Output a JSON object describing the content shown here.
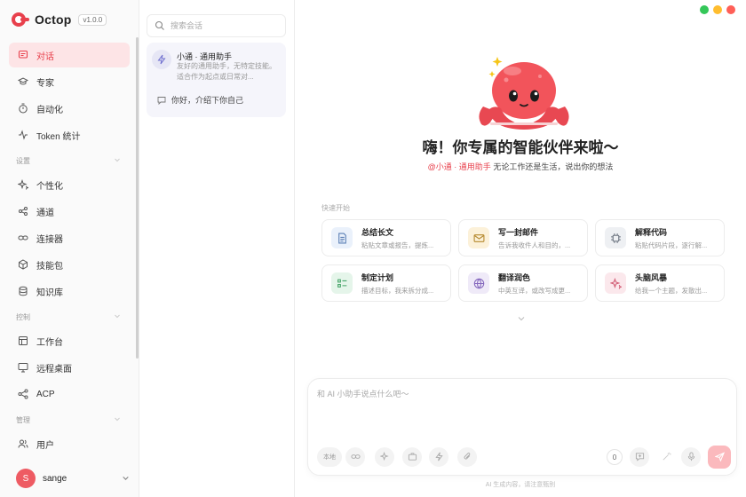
{
  "app": {
    "name": "Octop",
    "version": "v1.0.0"
  },
  "sidebar": {
    "items_top": [
      {
        "label": "对话",
        "icon": "chat-icon",
        "active": true
      },
      {
        "label": "专家",
        "icon": "graduation-cap-icon"
      },
      {
        "label": "自动化",
        "icon": "timer-icon"
      },
      {
        "label": "Token 统计",
        "icon": "activity-icon"
      }
    ],
    "section_settings": "设置",
    "items_settings": [
      {
        "label": "个性化",
        "icon": "sparkles-icon"
      },
      {
        "label": "通道",
        "icon": "channel-icon"
      },
      {
        "label": "连接器",
        "icon": "link-icon"
      },
      {
        "label": "技能包",
        "icon": "package-icon"
      },
      {
        "label": "知识库",
        "icon": "database-icon"
      }
    ],
    "section_control": "控制",
    "items_control": [
      {
        "label": "工作台",
        "icon": "layout-icon"
      },
      {
        "label": "远程桌面",
        "icon": "monitor-icon"
      },
      {
        "label": "ACP",
        "icon": "share-icon"
      }
    ],
    "section_manage": "管理",
    "items_manage": [
      {
        "label": "用户",
        "icon": "users-icon"
      }
    ],
    "user": {
      "initial": "S",
      "name": "sange"
    }
  },
  "conversations": {
    "search_placeholder": "搜索会话",
    "card": {
      "title": "小通 · 通用助手",
      "desc": "友好的通用助手，无特定技能。适合作为起点或日常对...",
      "message": "你好，介绍下你自己"
    }
  },
  "main": {
    "title": "嗨！你专属的智能伙伴来啦～",
    "subtitle_tag": "@小通 · 通用助手",
    "subtitle_rest": " 无论工作还是生活，说出你的想法",
    "quick_start": "快速开始",
    "cards": [
      {
        "title": "总结长文",
        "desc": "粘贴文章或报告，提炼...",
        "icon": "document-icon",
        "bg": "#eaf1fb",
        "fg": "#5b7fb5"
      },
      {
        "title": "写一封邮件",
        "desc": "告诉我收件人和目的，...",
        "icon": "mail-icon",
        "bg": "#fcf1d9",
        "fg": "#b5892e"
      },
      {
        "title": "解释代码",
        "desc": "粘贴代码片段，逐行解...",
        "icon": "chip-icon",
        "bg": "#eef0f3",
        "fg": "#6c7480"
      },
      {
        "title": "制定计划",
        "desc": "描述目标，我来拆分成...",
        "icon": "checklist-icon",
        "bg": "#e5f5ea",
        "fg": "#45a468"
      },
      {
        "title": "翻译润色",
        "desc": "中英互译，或改写成更...",
        "icon": "globe-icon",
        "bg": "#efeaf8",
        "fg": "#8467bd"
      },
      {
        "title": "头脑风暴",
        "desc": "给我一个主题，发散出...",
        "icon": "sparkle-icon",
        "bg": "#fbe8ec",
        "fg": "#d25c74"
      }
    ],
    "composer": {
      "placeholder": "和 AI 小助手说点什么吧～",
      "counter": "0",
      "chip_label": "本地"
    },
    "disclaimer": "AI 生成内容，请注意甄别"
  },
  "colors": {
    "accent": "#e8404c",
    "active_bg": "#fde4e6",
    "mascot": "#f2545b"
  }
}
